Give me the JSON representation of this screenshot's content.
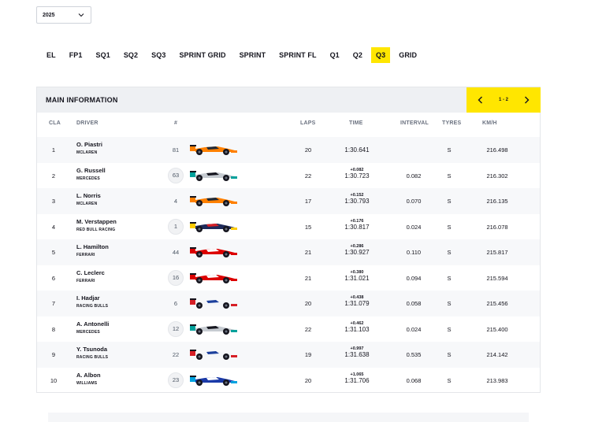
{
  "year_select": {
    "value": "2025",
    "icon": "chevron-down-icon"
  },
  "tabs": [
    {
      "label": "EL",
      "active": false
    },
    {
      "label": "FP1",
      "active": false
    },
    {
      "label": "SQ1",
      "active": false
    },
    {
      "label": "SQ2",
      "active": false
    },
    {
      "label": "SQ3",
      "active": false
    },
    {
      "label": "SPRINT GRID",
      "active": false
    },
    {
      "label": "SPRINT",
      "active": false
    },
    {
      "label": "SPRINT FL",
      "active": false
    },
    {
      "label": "Q1",
      "active": false
    },
    {
      "label": "Q2",
      "active": false
    },
    {
      "label": "Q3",
      "active": true
    },
    {
      "label": "GRID",
      "active": false
    }
  ],
  "section": {
    "title": "MAIN INFORMATION",
    "pager": {
      "label": "1 - 2",
      "prev_icon": "chevron-left-icon",
      "next_icon": "chevron-right-icon"
    }
  },
  "columns": {
    "cla": "CLA",
    "driver": "DRIVER",
    "number": "#",
    "laps": "LAPS",
    "time": "TIME",
    "interval": "INTERVAL",
    "tyres": "TYRES",
    "kmh": "KM/H"
  },
  "colors": {
    "accent": "#ffe600",
    "header_bg": "#eef0f3"
  },
  "rows": [
    {
      "pos": "1",
      "driver": "O. Piastri",
      "team": "MCLAREN",
      "number": "81",
      "circle": false,
      "car": "mclaren",
      "laps": "20",
      "gap": "",
      "time": "1:30.641",
      "interval": "",
      "tyre": "S",
      "kmh": "216.498"
    },
    {
      "pos": "2",
      "driver": "G. Russell",
      "team": "MERCEDES",
      "number": "63",
      "circle": true,
      "car": "mercedes",
      "laps": "22",
      "gap": "+0.082",
      "time": "1:30.723",
      "interval": "0.082",
      "tyre": "S",
      "kmh": "216.302"
    },
    {
      "pos": "3",
      "driver": "L. Norris",
      "team": "MCLAREN",
      "number": "4",
      "circle": false,
      "car": "mclaren",
      "laps": "17",
      "gap": "+0.152",
      "time": "1:30.793",
      "interval": "0.070",
      "tyre": "S",
      "kmh": "216.135"
    },
    {
      "pos": "4",
      "driver": "M. Verstappen",
      "team": "RED BULL RACING",
      "number": "1",
      "circle": true,
      "car": "redbull",
      "laps": "15",
      "gap": "+0.176",
      "time": "1:30.817",
      "interval": "0.024",
      "tyre": "S",
      "kmh": "216.078"
    },
    {
      "pos": "5",
      "driver": "L. Hamilton",
      "team": "FERRARI",
      "number": "44",
      "circle": false,
      "car": "ferrari",
      "laps": "21",
      "gap": "+0.286",
      "time": "1:30.927",
      "interval": "0.110",
      "tyre": "S",
      "kmh": "215.817"
    },
    {
      "pos": "6",
      "driver": "C. Leclerc",
      "team": "FERRARI",
      "number": "16",
      "circle": true,
      "car": "ferrari",
      "laps": "21",
      "gap": "+0.380",
      "time": "1:31.021",
      "interval": "0.094",
      "tyre": "S",
      "kmh": "215.594"
    },
    {
      "pos": "7",
      "driver": "I. Hadjar",
      "team": "RACING BULLS",
      "number": "6",
      "circle": false,
      "car": "racingbulls",
      "laps": "20",
      "gap": "+0.438",
      "time": "1:31.079",
      "interval": "0.058",
      "tyre": "S",
      "kmh": "215.456"
    },
    {
      "pos": "8",
      "driver": "A. Antonelli",
      "team": "MERCEDES",
      "number": "12",
      "circle": true,
      "car": "mercedes",
      "laps": "22",
      "gap": "+0.462",
      "time": "1:31.103",
      "interval": "0.024",
      "tyre": "S",
      "kmh": "215.400"
    },
    {
      "pos": "9",
      "driver": "Y. Tsunoda",
      "team": "RACING BULLS",
      "number": "22",
      "circle": false,
      "car": "racingbulls",
      "laps": "19",
      "gap": "+0.997",
      "time": "1:31.638",
      "interval": "0.535",
      "tyre": "S",
      "kmh": "214.142"
    },
    {
      "pos": "10",
      "driver": "A. Albon",
      "team": "WILLIAMS",
      "number": "23",
      "circle": true,
      "car": "williams",
      "laps": "20",
      "gap": "+1.065",
      "time": "1:31.706",
      "interval": "0.068",
      "tyre": "S",
      "kmh": "213.983"
    }
  ]
}
